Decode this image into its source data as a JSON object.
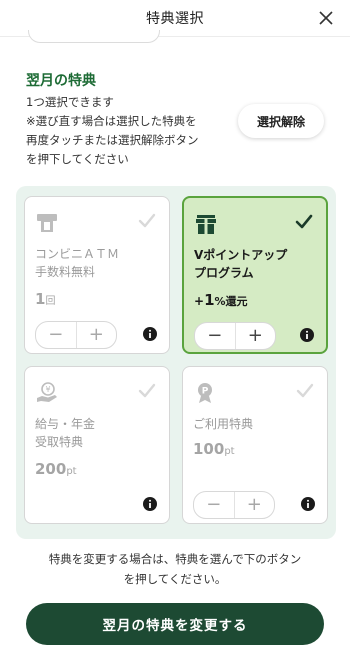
{
  "header": {
    "title": "特典選択"
  },
  "section": {
    "title": "翌月の特典",
    "desc": [
      "1つ選択できます",
      "※選び直す場合は選択した特典を",
      "再度タッチまたは選択解除ボタン",
      "を押下してください"
    ],
    "deselect_label": "選択解除"
  },
  "benefits": [
    {
      "name": [
        "コンビニＡＴＭ",
        "手数料無料"
      ],
      "value_prefix": "",
      "value": "1",
      "unit": "回",
      "selected": false,
      "icon": "atm-icon"
    },
    {
      "name": [
        "Vポイントアップ",
        "プログラム"
      ],
      "value_prefix": "+",
      "value": "1",
      "unit": "%還元",
      "selected": true,
      "icon": "gift-icon"
    },
    {
      "name": [
        "給与・年金",
        "受取特典"
      ],
      "value_prefix": "",
      "value": "200",
      "unit": "pt",
      "selected": false,
      "icon": "yen-hand-icon"
    },
    {
      "name": [
        "ご利用特典"
      ],
      "value_prefix": "",
      "value": "100",
      "unit": "pt",
      "selected": false,
      "icon": "point-icon"
    }
  ],
  "stepper": {
    "minus": "−",
    "plus": "+"
  },
  "footer": {
    "note": [
      "特典を変更する場合は、特典を選んで下のボタン",
      "を押してください。"
    ],
    "button_label": "翌月の特典を変更する"
  },
  "colors": {
    "accent": "#1d4a33",
    "selected_bg": "#d5ebc4",
    "selected_border": "#5aa33d",
    "panel_bg": "#e9f3ee",
    "title_green": "#1d6b35"
  }
}
